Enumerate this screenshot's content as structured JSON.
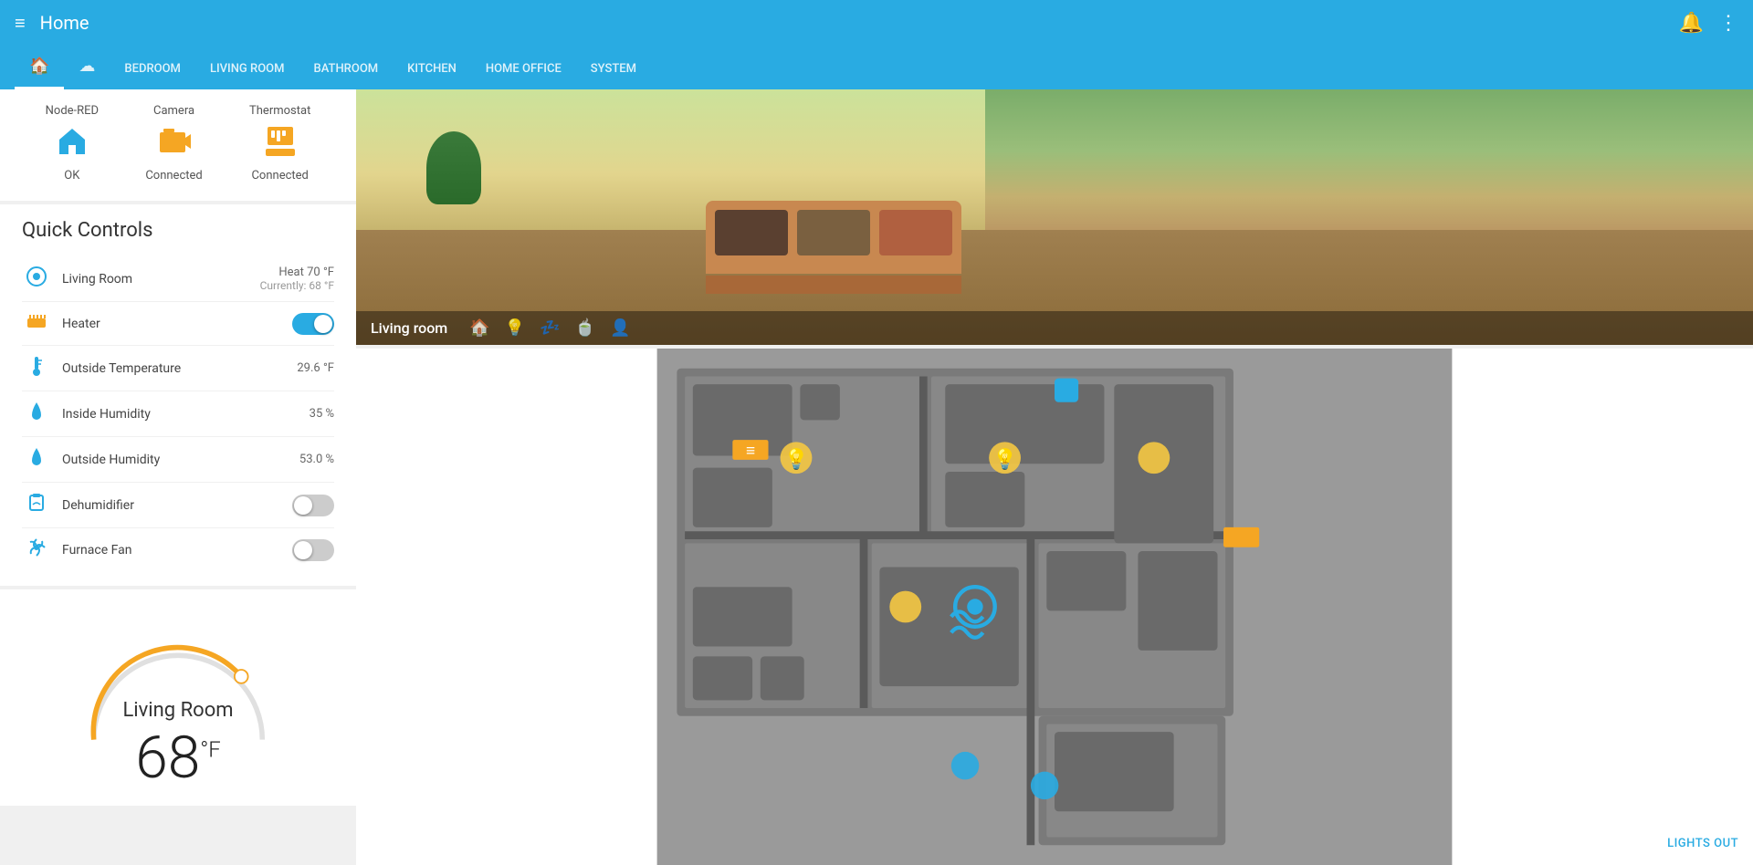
{
  "topBar": {
    "title": "Home",
    "menuIcon": "≡",
    "bellIcon": "🔔",
    "moreIcon": "⋮"
  },
  "navTabs": [
    {
      "label": "",
      "icon": "home",
      "active": true
    },
    {
      "label": "",
      "icon": "cloud",
      "active": false
    },
    {
      "label": "BEDROOM",
      "icon": "",
      "active": false
    },
    {
      "label": "LIVING ROOM",
      "icon": "",
      "active": false
    },
    {
      "label": "BATHROOM",
      "icon": "",
      "active": false
    },
    {
      "label": "KITCHEN",
      "icon": "",
      "active": false
    },
    {
      "label": "HOME OFFICE",
      "icon": "",
      "active": false
    },
    {
      "label": "SYSTEM",
      "icon": "",
      "active": false
    }
  ],
  "statusCard": {
    "items": [
      {
        "label": "Node-RED",
        "status": "OK"
      },
      {
        "label": "Camera",
        "status": "Connected"
      },
      {
        "label": "Thermostat",
        "status": "Connected"
      }
    ]
  },
  "quickControls": {
    "title": "Quick Controls",
    "rows": [
      {
        "icon": "thermostat",
        "iconColor": "blue",
        "label": "Living Room",
        "valueMain": "Heat 70 °F",
        "valueSub": "Currently: 68 °F",
        "type": "info"
      },
      {
        "icon": "heater",
        "iconColor": "yellow",
        "label": "Heater",
        "valueMain": "",
        "valueSub": "",
        "type": "toggle",
        "toggled": true
      },
      {
        "icon": "temp",
        "iconColor": "blue",
        "label": "Outside Temperature",
        "valueMain": "29.6 °F",
        "valueSub": "",
        "type": "value"
      },
      {
        "icon": "humidity",
        "iconColor": "blue",
        "label": "Inside Humidity",
        "valueMain": "35 %",
        "valueSub": "",
        "type": "value"
      },
      {
        "icon": "humidity",
        "iconColor": "blue",
        "label": "Outside Humidity",
        "valueMain": "53.0 %",
        "valueSub": "",
        "type": "value"
      },
      {
        "icon": "dehumidifier",
        "iconColor": "blue",
        "label": "Dehumidifier",
        "valueMain": "",
        "valueSub": "",
        "type": "toggle",
        "toggled": false
      },
      {
        "icon": "fan",
        "iconColor": "blue",
        "label": "Furnace Fan",
        "valueMain": "",
        "valueSub": "",
        "type": "toggle",
        "toggled": false
      }
    ]
  },
  "thermostat": {
    "room": "Living Room",
    "temp": "68",
    "unit": "°F"
  },
  "roomImage": {
    "label": "Living room"
  },
  "floorPlan": {
    "lightsOutLabel": "LIGHTS OUT"
  }
}
